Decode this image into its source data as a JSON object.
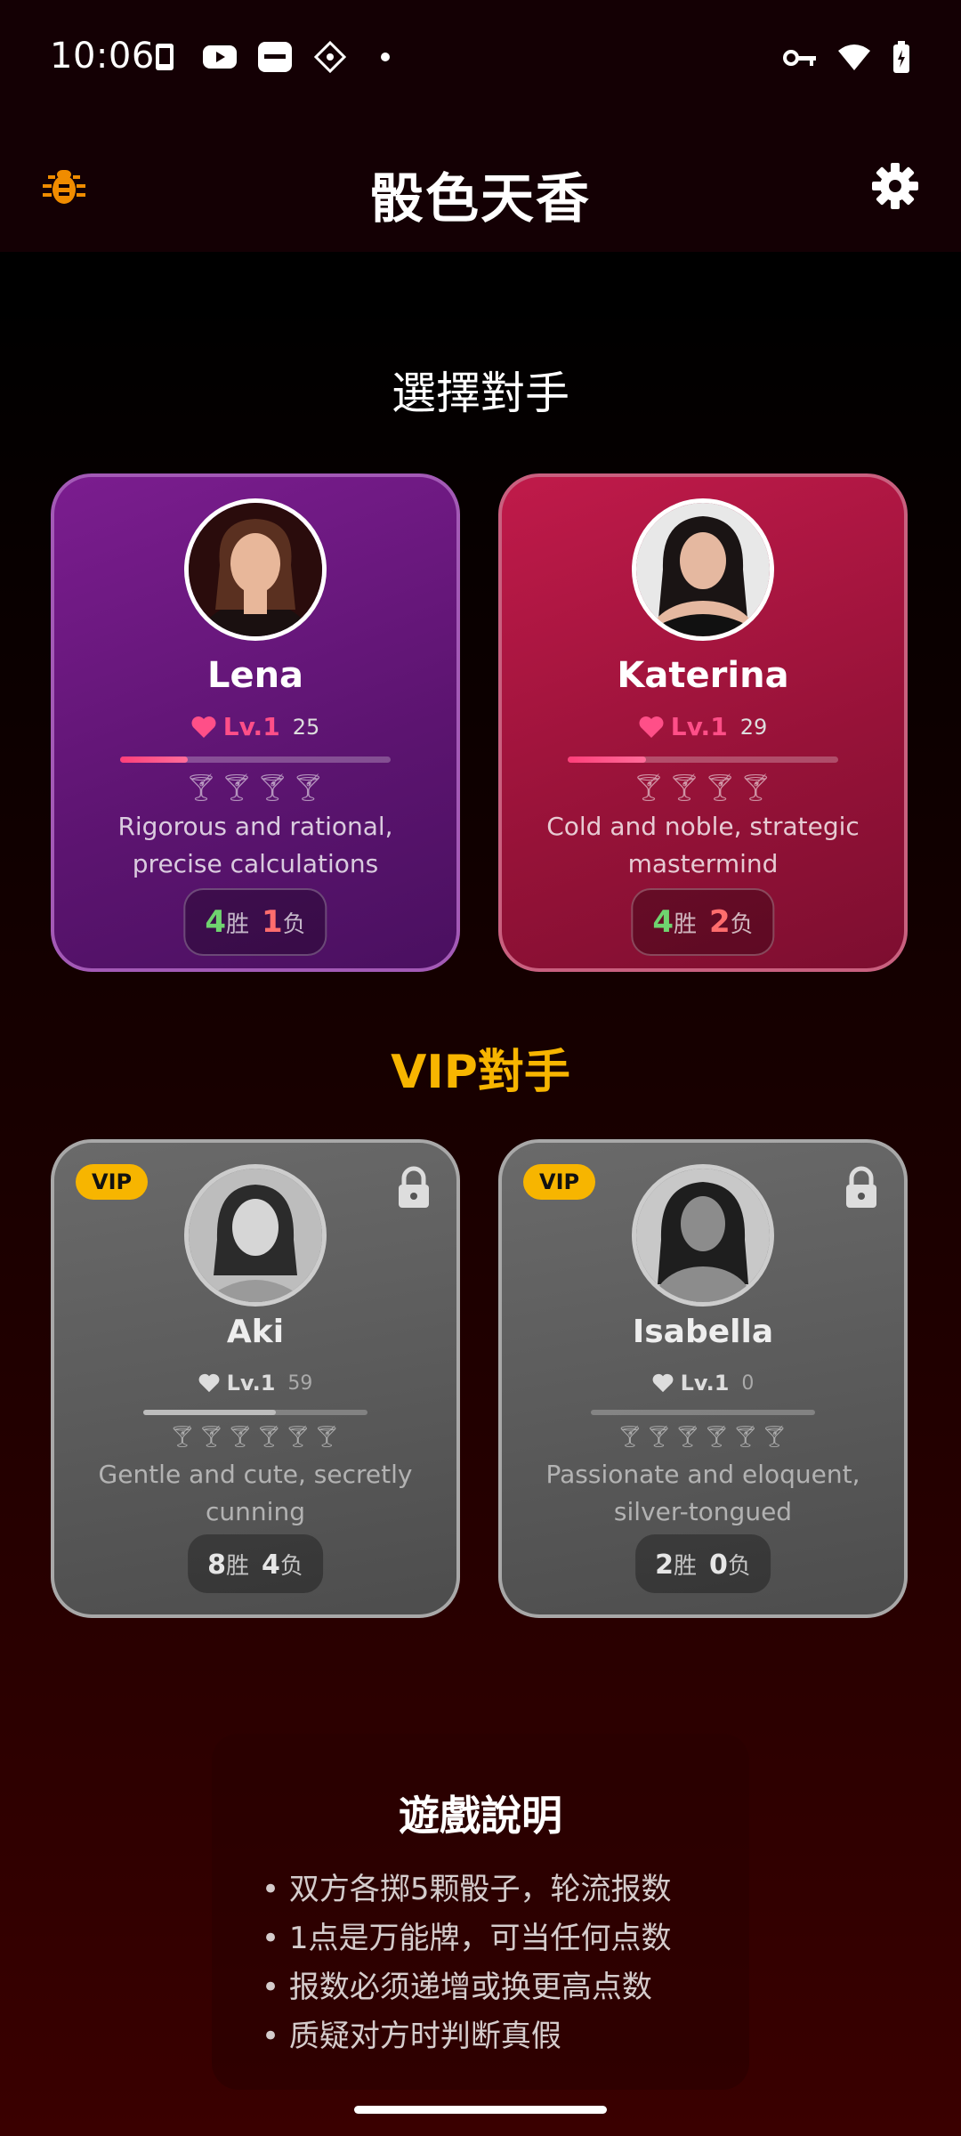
{
  "status_bar": {
    "time": "10:06"
  },
  "app": {
    "title": "骰色天香",
    "bug_icon": "bug-icon",
    "settings_icon": "gear-icon"
  },
  "sections": {
    "opponents": "選擇對手",
    "vip": "VIP對手"
  },
  "colors": {
    "accent_gold": "#f7b500",
    "level_pink": "#ff4f88",
    "win_green": "#6fd36f",
    "loss_red": "#ff6d6d"
  },
  "opponents": [
    {
      "name": "Lena",
      "level": "Lv.1",
      "points": "25",
      "progress": 0.25,
      "description": "Rigorous and rational, precise calculations",
      "wins": "4",
      "losses": "1",
      "win_label": "胜",
      "loss_label": "负"
    },
    {
      "name": "Katerina",
      "level": "Lv.1",
      "points": "29",
      "progress": 0.29,
      "description": "Cold and noble, strategic mastermind",
      "wins": "4",
      "losses": "2",
      "win_label": "胜",
      "loss_label": "负"
    }
  ],
  "vip_opponents": [
    {
      "badge": "VIP",
      "name": "Aki",
      "level": "Lv.1",
      "points": "59",
      "progress": 0.59,
      "description": "Gentle and cute, secretly cunning",
      "wins": "8",
      "losses": "4",
      "win_label": "胜",
      "loss_label": "负"
    },
    {
      "badge": "VIP",
      "name": "Isabella",
      "level": "Lv.1",
      "points": "0",
      "progress": 0.0,
      "description": "Passionate and eloquent, silver-tongued",
      "wins": "2",
      "losses": "0",
      "win_label": "胜",
      "loss_label": "负"
    }
  ],
  "howto": {
    "title": "遊戲說明",
    "rules": [
      "• 双方各掷5颗骰子，轮流报数",
      "• 1点是万能牌，可当任何点数",
      "• 报数必须递增或换更高点数",
      "• 质疑对方时判断真假"
    ]
  }
}
